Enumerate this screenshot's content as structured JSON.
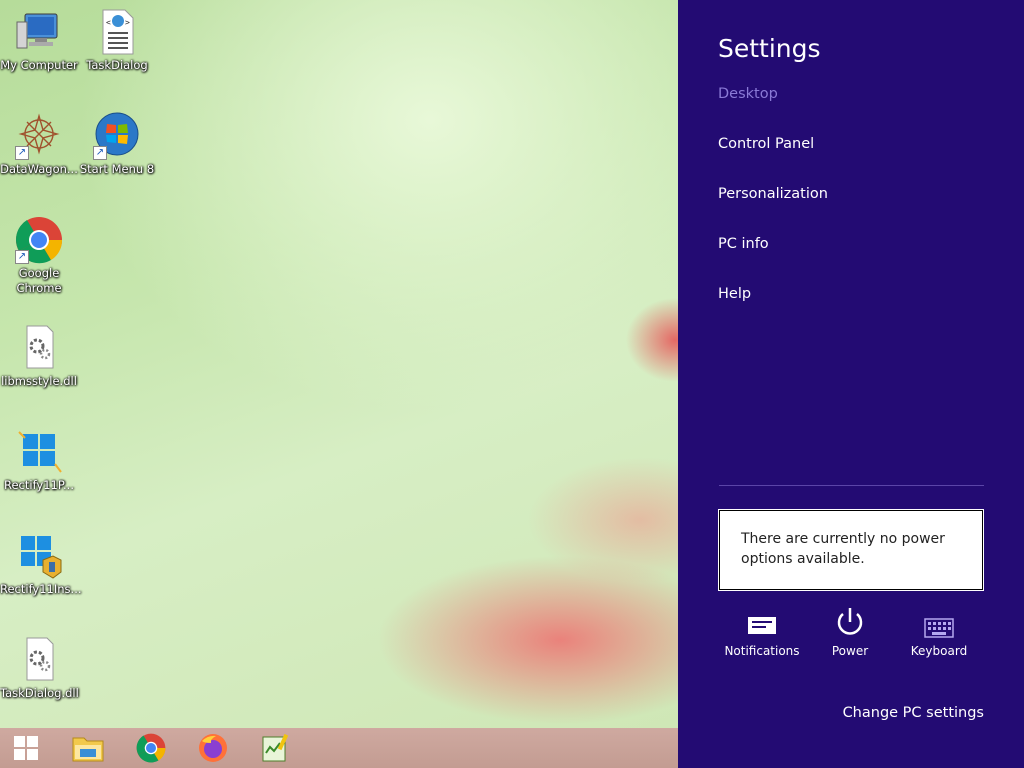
{
  "desktop": {
    "icons": [
      {
        "label": "My Computer",
        "icon": "computer-icon"
      },
      {
        "label": "TaskDialog",
        "icon": "html-document-icon"
      },
      {
        "label": "DataWagon...",
        "icon": "datawagon-icon"
      },
      {
        "label": "Start Menu 8",
        "icon": "windows-orb-icon"
      },
      {
        "label": "Google Chrome",
        "icon": "chrome-icon"
      },
      {
        "label": "libmsstyle.dll",
        "icon": "dll-file-icon"
      },
      {
        "label": "Rectify11P...",
        "icon": "windows11-logo-icon"
      },
      {
        "label": "Rectify11Ins...",
        "icon": "installer-icon"
      },
      {
        "label": "TaskDialog.dll",
        "icon": "dll-file-icon"
      }
    ]
  },
  "taskbar": {
    "items": [
      "start-button",
      "file-explorer-icon",
      "chrome-icon",
      "firefox-icon",
      "notepad-plus-icon"
    ]
  },
  "settings": {
    "title": "Settings",
    "context": "Desktop",
    "links": [
      "Control Panel",
      "Personalization",
      "PC info",
      "Help"
    ],
    "power_notice": "There are currently no power options available.",
    "quick": [
      {
        "label": "Notifications",
        "icon": "notifications-icon"
      },
      {
        "label": "Power",
        "icon": "power-icon"
      },
      {
        "label": "Keyboard",
        "icon": "keyboard-icon"
      }
    ],
    "change_link": "Change PC settings"
  },
  "colors": {
    "charms_bg": "#230b73",
    "context_text": "#8a7ad6"
  }
}
